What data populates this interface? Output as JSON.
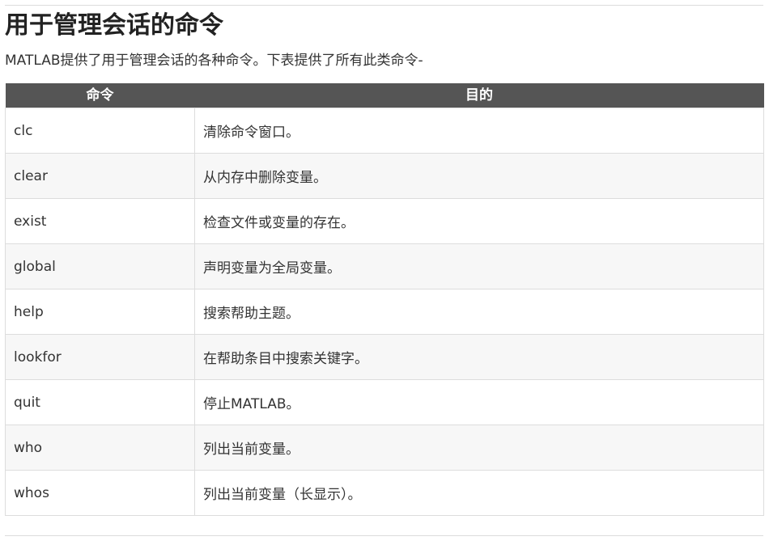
{
  "page": {
    "title": "用于管理会话的命令",
    "intro": "MATLAB提供了用于管理会话的各种命令。下表提供了所有此类命令-"
  },
  "table": {
    "headers": {
      "command": "命令",
      "purpose": "目的"
    },
    "rows": [
      {
        "command": "clc",
        "purpose": "清除命令窗口。"
      },
      {
        "command": "clear",
        "purpose": "从内存中删除变量。"
      },
      {
        "command": "exist",
        "purpose": "检查文件或变量的存在。"
      },
      {
        "command": "global",
        "purpose": "声明变量为全局变量。"
      },
      {
        "command": "help",
        "purpose": "搜索帮助主题。"
      },
      {
        "command": "lookfor",
        "purpose": "在帮助条目中搜索关键字。"
      },
      {
        "command": "quit",
        "purpose": "停止MATLAB。"
      },
      {
        "command": "who",
        "purpose": "列出当前变量。"
      },
      {
        "command": "whos",
        "purpose": "列出当前变量（长显示）。"
      }
    ]
  }
}
